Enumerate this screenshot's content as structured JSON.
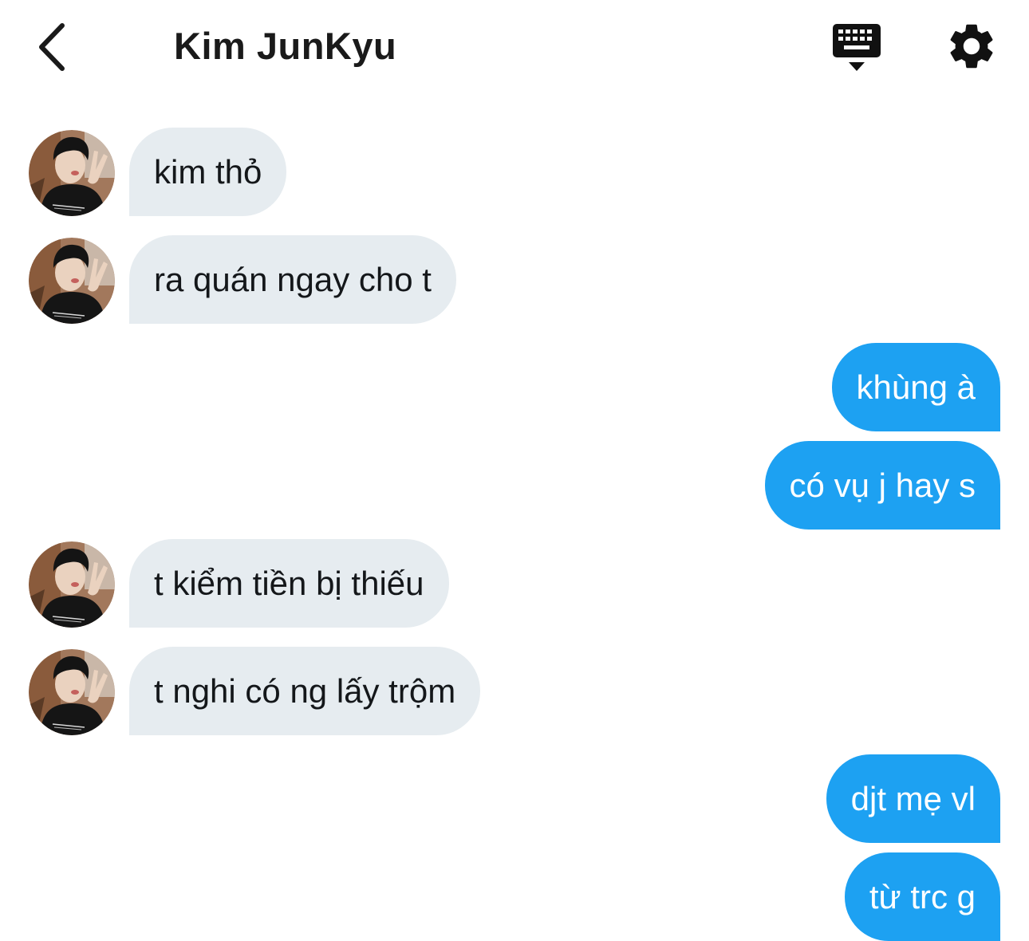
{
  "header": {
    "title": "Kim JunKyu",
    "back_icon": "chevron-left-icon",
    "keyboard_icon": "keyboard-icon",
    "settings_icon": "gear-icon"
  },
  "messages": [
    {
      "direction": "incoming",
      "text": "kim thỏ"
    },
    {
      "direction": "incoming",
      "text": "ra quán ngay cho t"
    },
    {
      "direction": "outgoing",
      "text": "khùng à"
    },
    {
      "direction": "outgoing",
      "text": "có vụ j hay s"
    },
    {
      "direction": "incoming",
      "text": "t kiểm tiền bị thiếu"
    },
    {
      "direction": "incoming",
      "text": "t nghi có ng lấy trộm"
    },
    {
      "direction": "outgoing",
      "text": "djt mẹ vl"
    },
    {
      "direction": "outgoing",
      "text": "từ trc g"
    }
  ],
  "colors": {
    "incoming_bubble": "#e6ecf0",
    "outgoing_bubble": "#1da1f2",
    "outgoing_text": "#ffffff",
    "text": "#14171a"
  }
}
